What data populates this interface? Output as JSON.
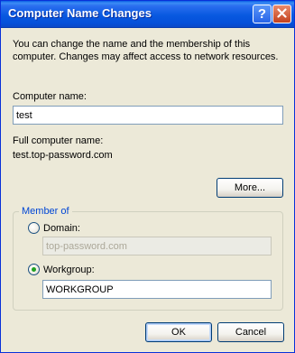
{
  "window": {
    "title": "Computer Name Changes",
    "help_button": "?",
    "close_button": "×"
  },
  "description": "You can change the name and the membership of this computer. Changes may affect access to network resources.",
  "computer_name": {
    "label": "Computer name:",
    "value": "test"
  },
  "full_computer_name": {
    "label": "Full computer name:",
    "value": "test.top-password.com"
  },
  "more_button": "More...",
  "member_of": {
    "legend": "Member of",
    "domain": {
      "label": "Domain:",
      "value": "top-password.com",
      "selected": false,
      "enabled": false
    },
    "workgroup": {
      "label": "Workgroup:",
      "value": "WORKGROUP",
      "selected": true
    }
  },
  "buttons": {
    "ok": "OK",
    "cancel": "Cancel"
  },
  "colors": {
    "titlebar": "#0A5FE4",
    "dialog_bg": "#ECE9D8",
    "group_legend": "#0046D5",
    "radio_selected": "#21A121"
  }
}
